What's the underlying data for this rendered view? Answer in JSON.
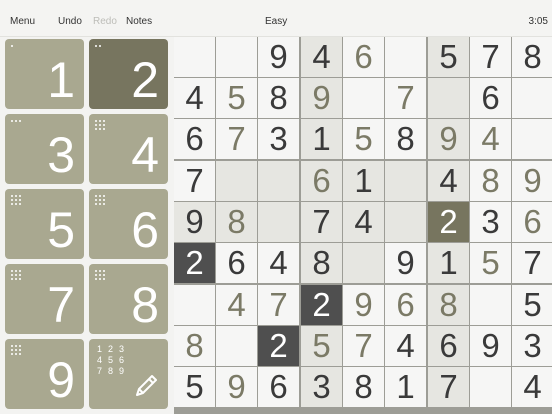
{
  "toolbar": {
    "menu_label": "Menu",
    "undo_label": "Undo",
    "redo_label": "Redo",
    "notes_label": "Notes",
    "difficulty": "Easy",
    "timer": "3:05"
  },
  "pad": {
    "tiles": [
      {
        "digit": "1",
        "remaining_dots": 1,
        "selected": false
      },
      {
        "digit": "2",
        "remaining_dots": 2,
        "selected": true
      },
      {
        "digit": "3",
        "remaining_dots": 3,
        "selected": false
      },
      {
        "digit": "4",
        "remaining_dots": 9,
        "selected": false
      },
      {
        "digit": "5",
        "remaining_dots": 9,
        "selected": false
      },
      {
        "digit": "6",
        "remaining_dots": 9,
        "selected": false
      },
      {
        "digit": "7",
        "remaining_dots": 9,
        "selected": false
      },
      {
        "digit": "8",
        "remaining_dots": 9,
        "selected": false
      },
      {
        "digit": "9",
        "remaining_dots": 9,
        "selected": false
      }
    ],
    "notes_tile": {
      "digits": [
        "1",
        "2",
        "3",
        "4",
        "5",
        "6",
        "7",
        "8",
        "9"
      ],
      "icon": "pencil-icon"
    }
  },
  "board": {
    "selected_digit": "2",
    "cells": [
      [
        "",
        "",
        "9",
        "4",
        "6",
        "",
        "5",
        "7",
        "8"
      ],
      [
        "4",
        "5",
        "8",
        "9",
        "",
        "7",
        "",
        "6",
        ""
      ],
      [
        "6",
        "7",
        "3",
        "1",
        "5",
        "8",
        "9",
        "4",
        ""
      ],
      [
        "7",
        "",
        "",
        "6",
        "1",
        "",
        "4",
        "8",
        "9"
      ],
      [
        "9",
        "8",
        "",
        "7",
        "4",
        "",
        "2",
        "3",
        "6"
      ],
      [
        "2",
        "6",
        "4",
        "8",
        "",
        "9",
        "1",
        "5",
        "7"
      ],
      [
        "",
        "4",
        "7",
        "2",
        "9",
        "6",
        "8",
        "",
        "5"
      ],
      [
        "8",
        "",
        "2",
        "5",
        "7",
        "4",
        "6",
        "9",
        "3"
      ],
      [
        "5",
        "9",
        "6",
        "3",
        "8",
        "1",
        "7",
        "",
        "4"
      ]
    ],
    "user_entries": [
      [
        0,
        4
      ],
      [
        1,
        1
      ],
      [
        1,
        3
      ],
      [
        1,
        5
      ],
      [
        2,
        1
      ],
      [
        2,
        4
      ],
      [
        2,
        6
      ],
      [
        2,
        7
      ],
      [
        3,
        3
      ],
      [
        3,
        7
      ],
      [
        3,
        8
      ],
      [
        4,
        1
      ],
      [
        4,
        8
      ],
      [
        5,
        7
      ],
      [
        6,
        1
      ],
      [
        6,
        2
      ],
      [
        6,
        4
      ],
      [
        6,
        5
      ],
      [
        6,
        6
      ],
      [
        7,
        0
      ],
      [
        7,
        3
      ],
      [
        7,
        4
      ],
      [
        8,
        1
      ]
    ],
    "highlight_columns": [
      3,
      6
    ],
    "highlight_cells": [
      [
        3,
        1
      ],
      [
        3,
        2
      ],
      [
        4,
        2
      ],
      [
        3,
        5
      ],
      [
        4,
        5
      ],
      [
        3,
        3
      ],
      [
        3,
        4
      ],
      [
        4,
        3
      ],
      [
        4,
        4
      ],
      [
        4,
        0
      ],
      [
        4,
        1
      ],
      [
        5,
        3
      ],
      [
        5,
        4
      ]
    ],
    "selected_cell": [
      4,
      6
    ],
    "same_digit_cells": [
      [
        5,
        0
      ],
      [
        6,
        3
      ],
      [
        7,
        2
      ]
    ],
    "colors": {
      "tile": "#a9a890",
      "tile_selected": "#77755f",
      "same_digit": "#4f4f4f",
      "highlight": "#e6e6e1"
    }
  }
}
